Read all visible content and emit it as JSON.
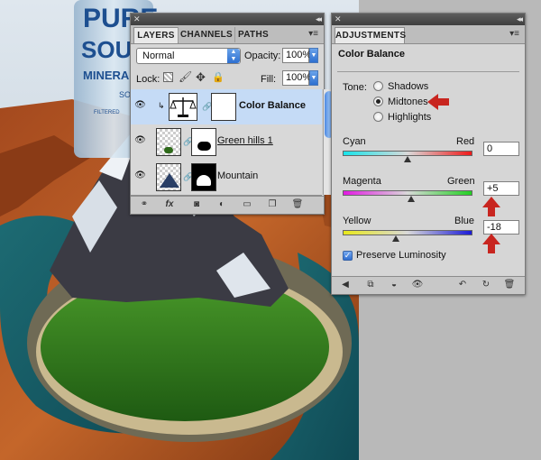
{
  "colors": {
    "accent": "#2d6fd0",
    "arrow": "#c8251f"
  },
  "artwork": {
    "bottle_label_lines": [
      "PURE",
      "SOU",
      "MINERA",
      "SO",
      "FILTERED"
    ]
  },
  "layers_panel": {
    "tabs": [
      {
        "label": "LAYERS",
        "active": true
      },
      {
        "label": "CHANNELS",
        "active": false
      },
      {
        "label": "PATHS",
        "active": false
      }
    ],
    "blend_mode": "Normal",
    "opacity_label": "Opacity:",
    "opacity_value": "100%",
    "lock_label": "Lock:",
    "fill_label": "Fill:",
    "fill_value": "100%",
    "layers": [
      {
        "name": "Color Balance",
        "selected": true
      },
      {
        "name": "Green hills 1",
        "selected": false
      },
      {
        "name": "Mountain",
        "selected": false
      }
    ]
  },
  "adjustments_panel": {
    "tab_label": "ADJUSTMENTS",
    "title": "Color Balance",
    "tone_label": "Tone:",
    "tone_options": [
      {
        "label": "Shadows",
        "selected": false
      },
      {
        "label": "Midtones",
        "selected": true
      },
      {
        "label": "Highlights",
        "selected": false
      }
    ],
    "sliders": [
      {
        "left": "Cyan",
        "right": "Red",
        "value": "0",
        "fraction": 0.5
      },
      {
        "left": "Magenta",
        "right": "Green",
        "value": "+5",
        "fraction": 0.525
      },
      {
        "left": "Yellow",
        "right": "Blue",
        "value": "-18",
        "fraction": 0.41
      }
    ],
    "preserve_label": "Preserve Luminosity",
    "preserve_checked": true
  }
}
